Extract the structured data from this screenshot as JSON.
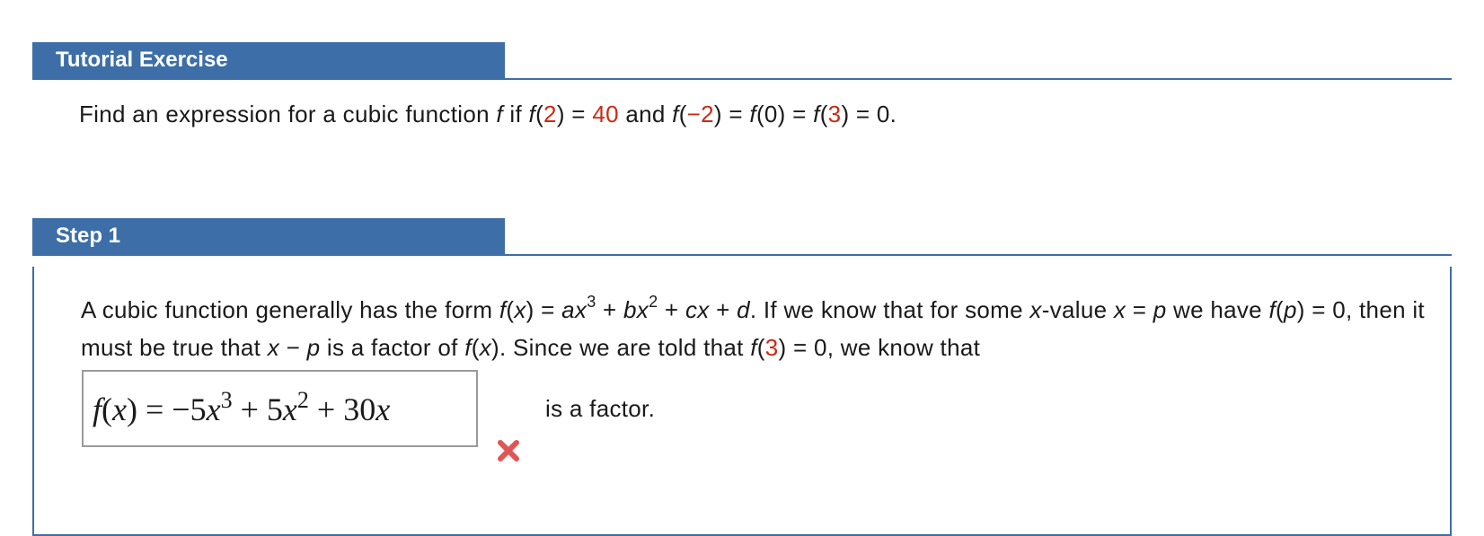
{
  "tutorial": {
    "header": "Tutorial Exercise"
  },
  "problem": {
    "p1": "Find an expression for a cubic function ",
    "f": "f",
    "p2": " if ",
    "f2": "f",
    "a1": "(",
    "arg1": "2",
    "a2": ") = ",
    "val": "40",
    "p3": " and ",
    "f3": "f",
    "b1": "(",
    "arg2": "−2",
    "b2": ") = ",
    "f4": "f",
    "c1": "(0) = ",
    "f5": "f",
    "d1": "(",
    "arg3": "3",
    "d2": ") = 0."
  },
  "step1": {
    "header": "Step 1",
    "t1": "A cubic function generally has the form ",
    "fx": "f",
    "t2": "(",
    "x1": "x",
    "t3": ") = ",
    "ax": "ax",
    "exp3": "3",
    "t4": " + ",
    "bx": "bx",
    "exp2": "2",
    "t5": " + ",
    "cx": "cx",
    "t6": " + ",
    "d": "d",
    "t7": ". If we know that for some ",
    "x2": "x",
    "t8": "-value ",
    "x3": "x",
    "t9": " = ",
    "p": "p",
    "t10": " we have ",
    "f6": "f",
    "t11": "(",
    "p2": "p",
    "t12": ") = 0, then it must be true that ",
    "x4": "x",
    "t13": " − ",
    "p3": "p",
    "t14": " is a factor of ",
    "f7": "f",
    "t15": "(",
    "x5": "x",
    "t16": "). Since we are told that ",
    "f8": "f",
    "t17": "(",
    "arg": "3",
    "t18": ") = 0, we know that",
    "answer": {
      "f": "f",
      "open": "(",
      "x": "x",
      "close": ")",
      "eq": " = −5",
      "x1": "x",
      "e1": "3",
      "plus1": " + 5",
      "x2": "x",
      "e2": "2",
      "plus2": " + 30",
      "x3": "x"
    },
    "status_icon": "x-mark-icon",
    "suffix": "is a factor."
  },
  "colors": {
    "accent": "#3d6ea8",
    "highlight": "#cc2a12",
    "error": "#e05555"
  }
}
